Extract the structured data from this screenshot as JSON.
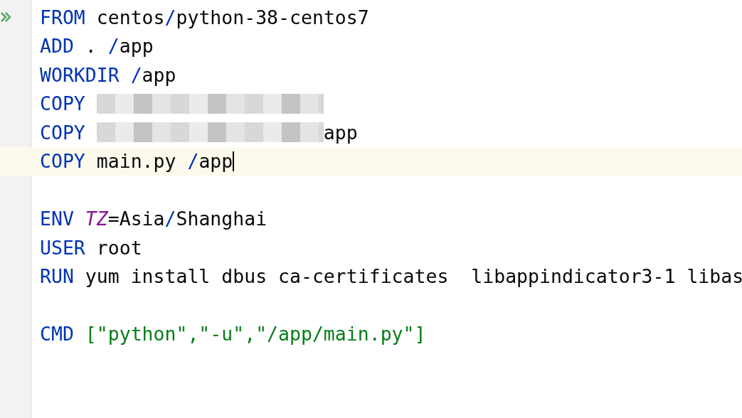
{
  "editor": {
    "lines": [
      {
        "run_marker": true,
        "current": false,
        "tokens": [
          {
            "kind": "keyword",
            "text": "FROM"
          },
          {
            "kind": "plain",
            "text": " centos"
          },
          {
            "kind": "slash",
            "text": "/"
          },
          {
            "kind": "plain",
            "text": "python-38-centos7"
          }
        ]
      },
      {
        "run_marker": false,
        "current": false,
        "tokens": [
          {
            "kind": "keyword",
            "text": "ADD"
          },
          {
            "kind": "plain",
            "text": " . "
          },
          {
            "kind": "slash",
            "text": "/"
          },
          {
            "kind": "plain",
            "text": "app"
          }
        ]
      },
      {
        "run_marker": false,
        "current": false,
        "tokens": [
          {
            "kind": "keyword",
            "text": "WORKDIR"
          },
          {
            "kind": "slash",
            "text": " /"
          },
          {
            "kind": "plain",
            "text": "app"
          }
        ]
      },
      {
        "run_marker": false,
        "current": false,
        "tokens": [
          {
            "kind": "keyword",
            "text": "COPY"
          },
          {
            "kind": "redacted"
          }
        ]
      },
      {
        "run_marker": false,
        "current": false,
        "tokens": [
          {
            "kind": "keyword",
            "text": "COPY"
          },
          {
            "kind": "redacted"
          },
          {
            "kind": "plain",
            "text": "app"
          }
        ]
      },
      {
        "run_marker": false,
        "current": true,
        "tokens": [
          {
            "kind": "keyword",
            "text": "COPY"
          },
          {
            "kind": "plain",
            "text": " main.py "
          },
          {
            "kind": "slash",
            "text": "/"
          },
          {
            "kind": "plain",
            "text": "app"
          }
        ]
      },
      {
        "run_marker": false,
        "current": false
      },
      {
        "run_marker": false,
        "current": false,
        "tokens": [
          {
            "kind": "keyword",
            "text": "ENV"
          },
          {
            "kind": "variable",
            "text": " TZ"
          },
          {
            "kind": "plain",
            "text": "=Asia"
          },
          {
            "kind": "slash",
            "text": "/"
          },
          {
            "kind": "plain",
            "text": "Shanghai"
          }
        ]
      },
      {
        "run_marker": false,
        "current": false,
        "tokens": [
          {
            "kind": "keyword",
            "text": "USER"
          },
          {
            "kind": "plain",
            "text": " root"
          }
        ]
      },
      {
        "run_marker": false,
        "current": false,
        "tokens": [
          {
            "kind": "keyword",
            "text": "RUN"
          },
          {
            "kind": "plain",
            "text": " yum install dbus ca-certificates  libappindicator3-1 libas"
          }
        ]
      },
      {
        "run_marker": false,
        "current": false
      },
      {
        "run_marker": false,
        "current": false,
        "tokens": [
          {
            "kind": "keyword",
            "text": "CMD"
          },
          {
            "kind": "string",
            "text": " [\"python\",\"-u\",\"/app/main.py\"]"
          }
        ]
      }
    ]
  }
}
